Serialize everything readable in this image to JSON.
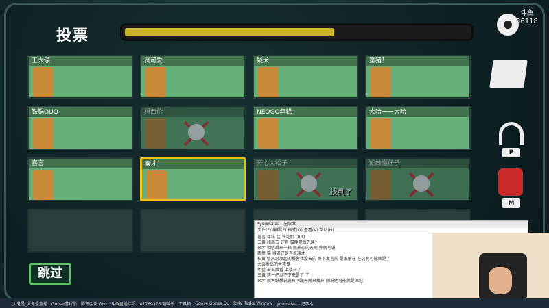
{
  "header": {
    "title": "投票",
    "timer_progress": 0.6
  },
  "colors": {
    "accent": "#c9b22e",
    "card_bg": "#67b07a",
    "selected_border": "#f2c01a",
    "skip_border": "#66c26a"
  },
  "cards": [
    {
      "name": "王大谋",
      "state": "alive"
    },
    {
      "name": "贤可爱",
      "state": "alive"
    },
    {
      "name": "疑犬",
      "state": "alive"
    },
    {
      "name": "童猪！",
      "state": "alive"
    },
    {
      "name": "铁锅QUQ",
      "state": "alive"
    },
    {
      "name": "柯西伦",
      "state": "dead"
    },
    {
      "name": "NEOGO年糕",
      "state": "alive"
    },
    {
      "name": "大哈一一大哈",
      "state": "alive"
    },
    {
      "name": "喜言",
      "state": "alive"
    },
    {
      "name": "秦才",
      "state": "selected"
    },
    {
      "name": "开心大松子",
      "state": "dead",
      "badge": "找到了"
    },
    {
      "name": "凯妹帽仔子",
      "state": "dead"
    },
    {
      "name": "",
      "state": "empty"
    },
    {
      "name": "",
      "state": "empty"
    },
    {
      "name": "",
      "state": "empty"
    },
    {
      "name": "",
      "state": "empty"
    }
  ],
  "skip_label": "跳过",
  "side": {
    "logo_label": "斗鱼",
    "room_number": "36118",
    "key_p": "P",
    "key_m": "M",
    "icons": [
      "gear-icon",
      "map-icon",
      "headphones-icon",
      "mic-muted-icon"
    ]
  },
  "notepad": {
    "title": "*youmaiaa - 记事本",
    "menu": "文件(F)  编辑(E)  格式(O)  查看(V)  帮助(H)",
    "lines": [
      "喜言 年糕 佳 铁宅奶 QUQ",
      "三黄 和高玉 还有 猫睡觉后先睡?",
      "奔才 相信后开一箱 就开心的天呢 外就写说",
      "西意    猫    得说还是有点凑才",
      "柏黄 信风念发起的报警我没去的 等下发言前 是谁留在 在这有可能就是了",
      "大谈发出的大死鬼",
      "年益  击说后看 上楼开了",
      "三黄 这一把以不下来是了 了",
      "奔才 就大好想说说有问题天就来找开 刚说他可能就是凶犯"
    ]
  },
  "taskbar": {
    "items": [
      "大鬼是_大鬼是直播",
      "Goose游戏加",
      "腾讯会议 Goo",
      "斗鱼直播伴侣",
      "01789375 鹅鸭杀",
      "工具箱",
      "Goose Goose Du",
      "RMV Tasks Window",
      "youmaiaa - 记事本"
    ]
  }
}
